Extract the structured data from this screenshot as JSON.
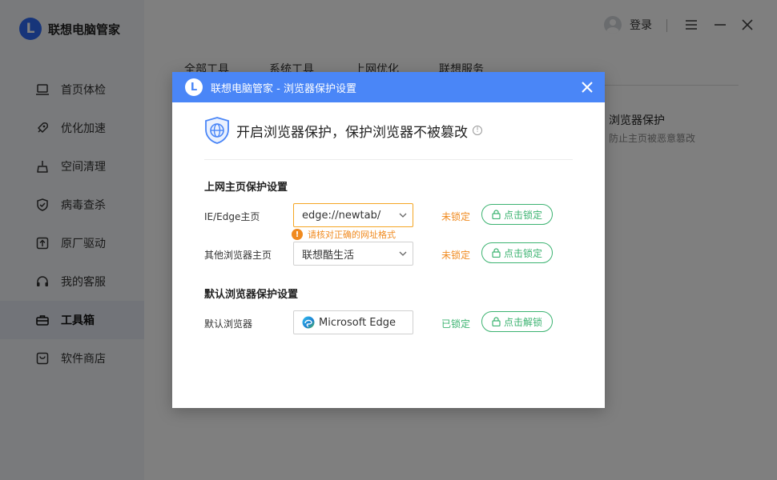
{
  "app": {
    "name": "联想电脑管家",
    "logo_letter": "L",
    "login_label": "登录"
  },
  "sidebar": {
    "items": [
      {
        "label": "首页体检",
        "icon": "laptop-icon"
      },
      {
        "label": "优化加速",
        "icon": "rocket-icon"
      },
      {
        "label": "空间清理",
        "icon": "broom-icon"
      },
      {
        "label": "病毒查杀",
        "icon": "shield-check-icon"
      },
      {
        "label": "原厂驱动",
        "icon": "upload-box-icon"
      },
      {
        "label": "我的客服",
        "icon": "headset-icon"
      },
      {
        "label": "工具箱",
        "icon": "toolbox-icon",
        "active": true
      },
      {
        "label": "软件商店",
        "icon": "store-bag-icon"
      }
    ]
  },
  "tabs": [
    "全部工具",
    "系统工具",
    "上网优化",
    "联想服务"
  ],
  "bg_card": {
    "title": "浏览器保护",
    "subtitle": "防止主页被恶意篡改"
  },
  "dialog": {
    "title": "联想电脑管家 - 浏览器保护设置",
    "hero_text": "开启浏览器保护，保护浏览器不被篡改",
    "homepage_section_title": "上网主页保护设置",
    "default_section_title": "默认浏览器保护设置",
    "rows": {
      "ie_edge": {
        "label": "IE/Edge主页",
        "value": "edge://newtab/",
        "status": "未锁定",
        "button": "点击锁定"
      },
      "other": {
        "label": "其他浏览器主页",
        "value": "联想酷生活",
        "status": "未锁定",
        "button": "点击锁定"
      },
      "default_browser": {
        "label": "默认浏览器",
        "value": "Microsoft Edge",
        "status": "已锁定",
        "button": "点击解锁"
      }
    },
    "warning": "请核对正确的网址格式"
  },
  "colors": {
    "accent": "#4a86f7",
    "status_unlocked": "#f08a1f",
    "status_locked": "#3cb371"
  }
}
